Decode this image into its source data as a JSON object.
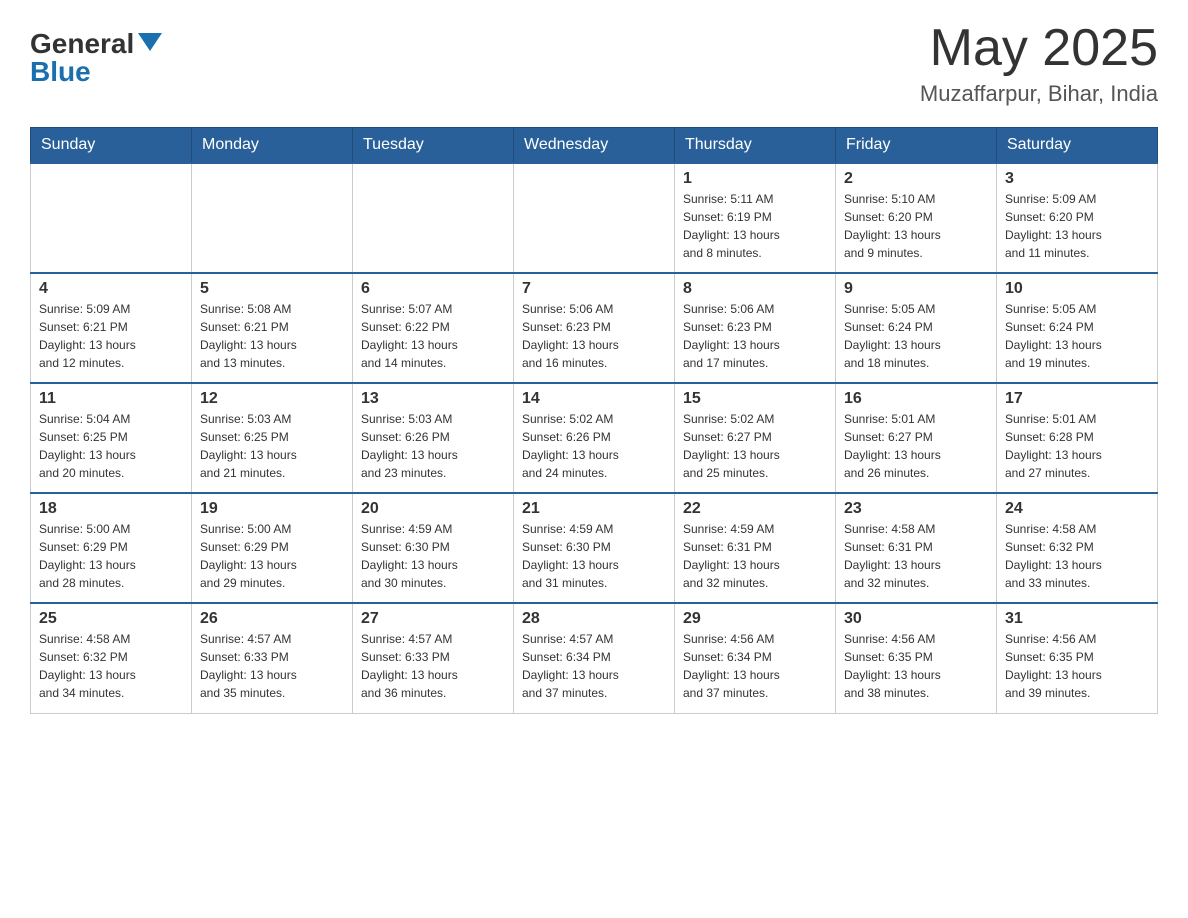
{
  "header": {
    "logo": {
      "general": "General",
      "blue": "Blue"
    },
    "title": "May 2025",
    "location": "Muzaffarpur, Bihar, India"
  },
  "days_of_week": [
    "Sunday",
    "Monday",
    "Tuesday",
    "Wednesday",
    "Thursday",
    "Friday",
    "Saturday"
  ],
  "weeks": [
    {
      "days": [
        {
          "number": "",
          "info": ""
        },
        {
          "number": "",
          "info": ""
        },
        {
          "number": "",
          "info": ""
        },
        {
          "number": "",
          "info": ""
        },
        {
          "number": "1",
          "info": "Sunrise: 5:11 AM\nSunset: 6:19 PM\nDaylight: 13 hours\nand 8 minutes."
        },
        {
          "number": "2",
          "info": "Sunrise: 5:10 AM\nSunset: 6:20 PM\nDaylight: 13 hours\nand 9 minutes."
        },
        {
          "number": "3",
          "info": "Sunrise: 5:09 AM\nSunset: 6:20 PM\nDaylight: 13 hours\nand 11 minutes."
        }
      ]
    },
    {
      "days": [
        {
          "number": "4",
          "info": "Sunrise: 5:09 AM\nSunset: 6:21 PM\nDaylight: 13 hours\nand 12 minutes."
        },
        {
          "number": "5",
          "info": "Sunrise: 5:08 AM\nSunset: 6:21 PM\nDaylight: 13 hours\nand 13 minutes."
        },
        {
          "number": "6",
          "info": "Sunrise: 5:07 AM\nSunset: 6:22 PM\nDaylight: 13 hours\nand 14 minutes."
        },
        {
          "number": "7",
          "info": "Sunrise: 5:06 AM\nSunset: 6:23 PM\nDaylight: 13 hours\nand 16 minutes."
        },
        {
          "number": "8",
          "info": "Sunrise: 5:06 AM\nSunset: 6:23 PM\nDaylight: 13 hours\nand 17 minutes."
        },
        {
          "number": "9",
          "info": "Sunrise: 5:05 AM\nSunset: 6:24 PM\nDaylight: 13 hours\nand 18 minutes."
        },
        {
          "number": "10",
          "info": "Sunrise: 5:05 AM\nSunset: 6:24 PM\nDaylight: 13 hours\nand 19 minutes."
        }
      ]
    },
    {
      "days": [
        {
          "number": "11",
          "info": "Sunrise: 5:04 AM\nSunset: 6:25 PM\nDaylight: 13 hours\nand 20 minutes."
        },
        {
          "number": "12",
          "info": "Sunrise: 5:03 AM\nSunset: 6:25 PM\nDaylight: 13 hours\nand 21 minutes."
        },
        {
          "number": "13",
          "info": "Sunrise: 5:03 AM\nSunset: 6:26 PM\nDaylight: 13 hours\nand 23 minutes."
        },
        {
          "number": "14",
          "info": "Sunrise: 5:02 AM\nSunset: 6:26 PM\nDaylight: 13 hours\nand 24 minutes."
        },
        {
          "number": "15",
          "info": "Sunrise: 5:02 AM\nSunset: 6:27 PM\nDaylight: 13 hours\nand 25 minutes."
        },
        {
          "number": "16",
          "info": "Sunrise: 5:01 AM\nSunset: 6:27 PM\nDaylight: 13 hours\nand 26 minutes."
        },
        {
          "number": "17",
          "info": "Sunrise: 5:01 AM\nSunset: 6:28 PM\nDaylight: 13 hours\nand 27 minutes."
        }
      ]
    },
    {
      "days": [
        {
          "number": "18",
          "info": "Sunrise: 5:00 AM\nSunset: 6:29 PM\nDaylight: 13 hours\nand 28 minutes."
        },
        {
          "number": "19",
          "info": "Sunrise: 5:00 AM\nSunset: 6:29 PM\nDaylight: 13 hours\nand 29 minutes."
        },
        {
          "number": "20",
          "info": "Sunrise: 4:59 AM\nSunset: 6:30 PM\nDaylight: 13 hours\nand 30 minutes."
        },
        {
          "number": "21",
          "info": "Sunrise: 4:59 AM\nSunset: 6:30 PM\nDaylight: 13 hours\nand 31 minutes."
        },
        {
          "number": "22",
          "info": "Sunrise: 4:59 AM\nSunset: 6:31 PM\nDaylight: 13 hours\nand 32 minutes."
        },
        {
          "number": "23",
          "info": "Sunrise: 4:58 AM\nSunset: 6:31 PM\nDaylight: 13 hours\nand 32 minutes."
        },
        {
          "number": "24",
          "info": "Sunrise: 4:58 AM\nSunset: 6:32 PM\nDaylight: 13 hours\nand 33 minutes."
        }
      ]
    },
    {
      "days": [
        {
          "number": "25",
          "info": "Sunrise: 4:58 AM\nSunset: 6:32 PM\nDaylight: 13 hours\nand 34 minutes."
        },
        {
          "number": "26",
          "info": "Sunrise: 4:57 AM\nSunset: 6:33 PM\nDaylight: 13 hours\nand 35 minutes."
        },
        {
          "number": "27",
          "info": "Sunrise: 4:57 AM\nSunset: 6:33 PM\nDaylight: 13 hours\nand 36 minutes."
        },
        {
          "number": "28",
          "info": "Sunrise: 4:57 AM\nSunset: 6:34 PM\nDaylight: 13 hours\nand 37 minutes."
        },
        {
          "number": "29",
          "info": "Sunrise: 4:56 AM\nSunset: 6:34 PM\nDaylight: 13 hours\nand 37 minutes."
        },
        {
          "number": "30",
          "info": "Sunrise: 4:56 AM\nSunset: 6:35 PM\nDaylight: 13 hours\nand 38 minutes."
        },
        {
          "number": "31",
          "info": "Sunrise: 4:56 AM\nSunset: 6:35 PM\nDaylight: 13 hours\nand 39 minutes."
        }
      ]
    }
  ]
}
